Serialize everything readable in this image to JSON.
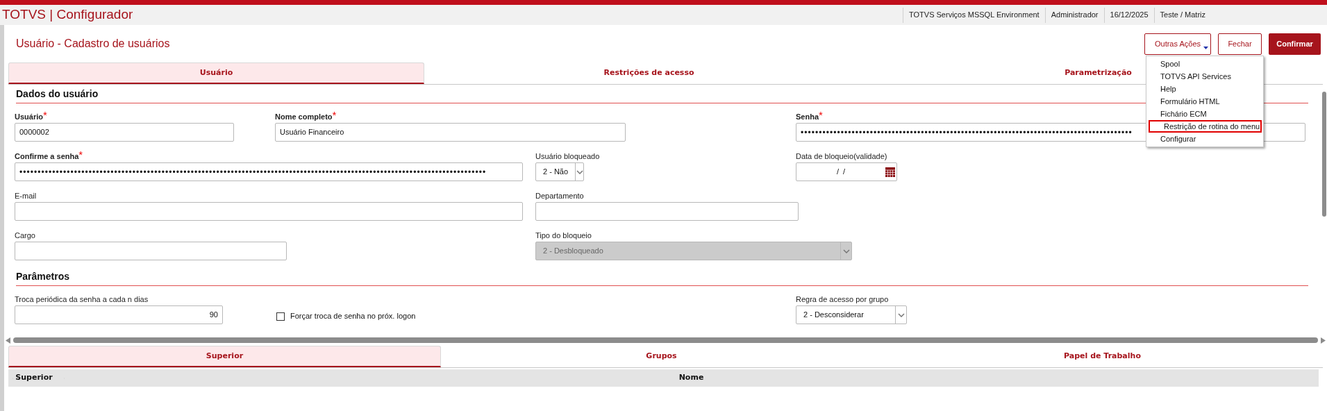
{
  "header": {
    "app_title": "TOTVS | Configurador",
    "info": [
      "TOTVS Serviços MSSQL Environment",
      "Administrador",
      "16/12/2025",
      "Teste / Matriz"
    ]
  },
  "page_title": "Usuário - Cadastro de usuários",
  "actions": [
    {
      "label": "Outras Ações",
      "kind": "menu"
    },
    {
      "label": "Fechar",
      "kind": "outline"
    },
    {
      "label": "Confirmar",
      "kind": "primary"
    }
  ],
  "menu": {
    "items": [
      {
        "label": "Spool",
        "highlighted": false
      },
      {
        "label": "TOTVS API Services",
        "highlighted": false
      },
      {
        "label": "Help",
        "highlighted": false
      },
      {
        "label": "Formulário HTML",
        "highlighted": false
      },
      {
        "label": "Fichário ECM",
        "highlighted": false
      },
      {
        "label": "Restrição de rotina do menu",
        "highlighted": true
      },
      {
        "label": "Configurar",
        "highlighted": false
      }
    ]
  },
  "tabs": [
    {
      "label": "Usuário",
      "selected": true
    },
    {
      "label": "Restrições de acesso",
      "selected": false
    },
    {
      "label": "Parametrização",
      "selected": false
    }
  ],
  "sections": [
    {
      "title": "Dados do usuário",
      "rows": [
        [
          {
            "label": "Usuário",
            "required_mark": "*",
            "kind": "text",
            "value": "0000002"
          },
          {
            "label": "Nome completo",
            "required_mark": "*",
            "kind": "text",
            "value": "Usuário Financeiro"
          },
          {
            "label": "Senha",
            "required_mark": "*",
            "kind": "password",
            "value": "•••••••••••••••••••••••••••••••••••••••••••••••••••••••••••••••••••••••••••••••••••••••••••"
          }
        ],
        [
          {
            "label": "Confirme a senha",
            "required_mark": "*",
            "kind": "password",
            "value": "••••••••••••••••••••••••••••••••••••••••••••••••••••••••••••••••••••••••••••••••••••••••••••••••••••••••••••••••••••••••••••••••"
          },
          {
            "label": "Usuário bloqueado",
            "kind": "select",
            "value": "2 - Não"
          },
          {
            "label": "Data de bloqueio(validade)",
            "kind": "date",
            "value": "/  /"
          }
        ],
        [
          {
            "label": "E-mail",
            "kind": "text"
          },
          {
            "label": "Departamento",
            "kind": "text"
          }
        ],
        [
          {
            "label": "Cargo",
            "kind": "text"
          },
          {
            "label": "Tipo do bloqueio",
            "kind": "select",
            "value": "2 - Desbloqueado",
            "disabled": true
          }
        ]
      ]
    },
    {
      "title": "Parâmetros",
      "rows": [
        [
          {
            "label": "Troca periódica da senha a cada n dias",
            "kind": "number",
            "value": "90"
          },
          {
            "label": "Forçar troca de senha no próx. logon",
            "kind": "checkbox",
            "checked": false
          },
          {
            "label": "Regra de acesso por grupo",
            "kind": "select",
            "value": "2 - Desconsiderar"
          }
        ]
      ]
    }
  ],
  "bottom_tabs": [
    {
      "label": "Superior",
      "selected": true
    },
    {
      "label": "Grupos",
      "selected": false
    },
    {
      "label": "Papel de Trabalho",
      "selected": false
    }
  ],
  "grid": {
    "columns": [
      "Superior",
      "Nome"
    ]
  }
}
